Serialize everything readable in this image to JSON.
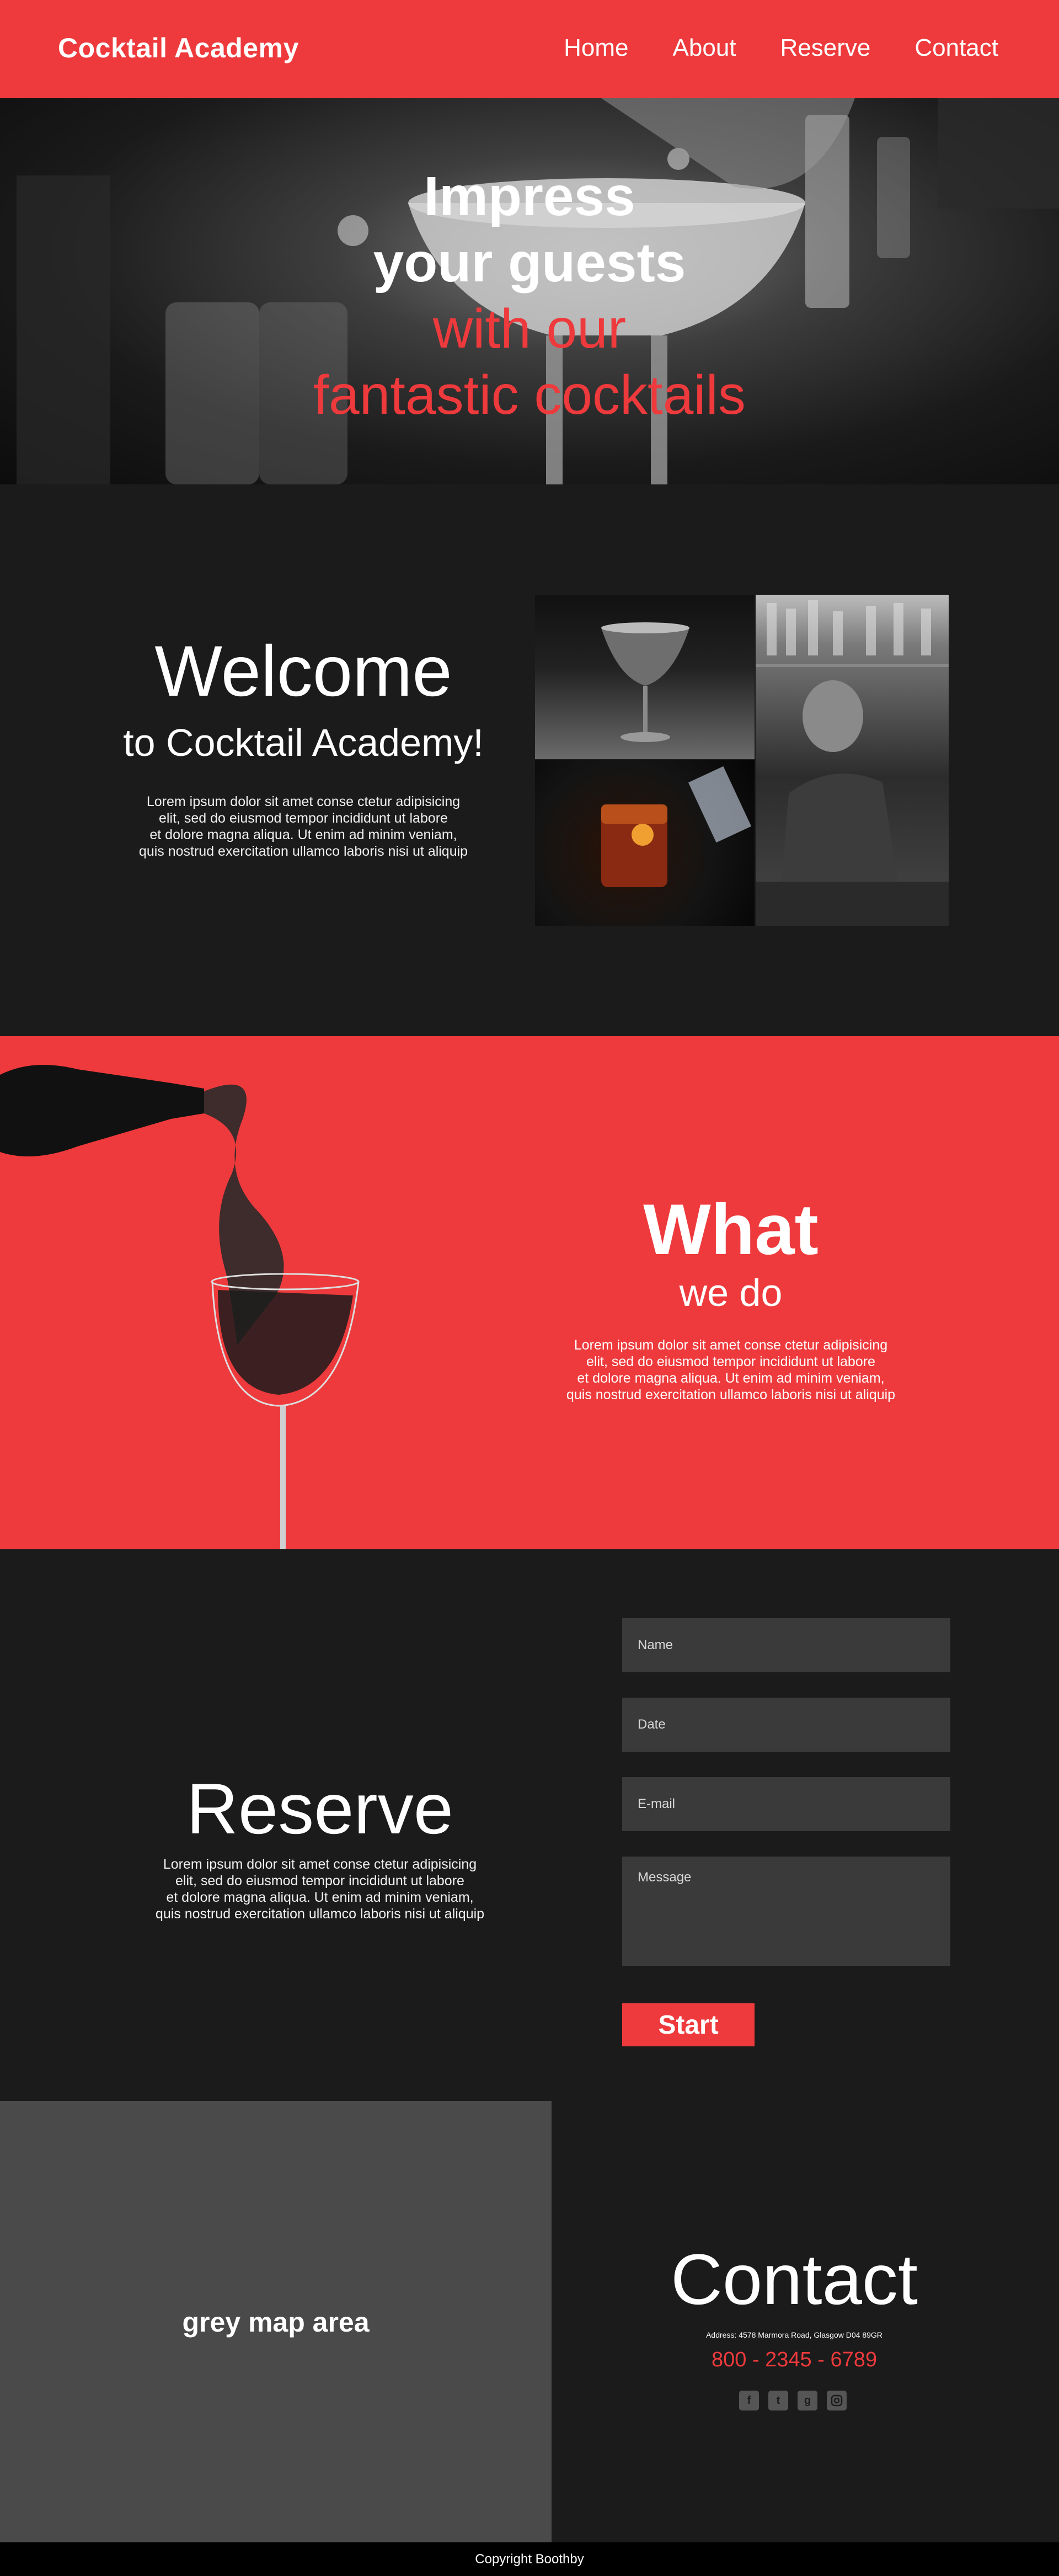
{
  "header": {
    "brand": "Cocktail Academy",
    "nav": [
      "Home",
      "About",
      "Reserve",
      "Contact"
    ]
  },
  "hero": {
    "line1": "Impress",
    "line2": "your guests",
    "line3": "with our",
    "line4": "fantastic cocktails"
  },
  "welcome": {
    "title": "Welcome",
    "subtitle": "to Cocktail Academy!",
    "body": [
      "Lorem ipsum dolor sit amet conse ctetur adipisicing",
      "elit, sed do eiusmod tempor  incididunt ut labore",
      "et dolore magna aliqua.  Ut enim ad minim veniam,",
      "quis nostrud exercitation ullamco laboris nisi ut aliquip"
    ]
  },
  "what": {
    "title": "What",
    "subtitle": "we do",
    "body": [
      "Lorem ipsum dolor sit amet conse ctetur adipisicing",
      "elit, sed do eiusmod tempor  incididunt ut labore",
      "et dolore magna aliqua.  Ut enim ad minim veniam,",
      "quis nostrud exercitation ullamco laboris nisi ut aliquip"
    ]
  },
  "reserve": {
    "title": "Reserve",
    "body": [
      "Lorem ipsum dolor sit amet conse ctetur adipisicing",
      "elit, sed do eiusmod tempor  incididunt ut labore",
      "et dolore magna aliqua.  Ut enim ad minim veniam,",
      "quis nostrud exercitation ullamco laboris nisi ut aliquip"
    ],
    "form": {
      "name_placeholder": "Name",
      "date_placeholder": "Date",
      "email_placeholder": "E-mail",
      "message_placeholder": "Message",
      "submit_label": "Start"
    }
  },
  "map": {
    "label": "grey map area"
  },
  "contact": {
    "title": "Contact",
    "address": "Address: 4578 Marmora Road, Glasgow D04 89GR",
    "phone": "800 - 2345 - 6789",
    "social_icons": [
      "facebook-icon",
      "twitter-icon",
      "google-plus-icon",
      "instagram-icon"
    ]
  },
  "footer": {
    "copyright": "Copyright Boothby"
  },
  "colors": {
    "accent": "#ee3a3c",
    "dark": "#1b1b1b",
    "field": "#3a3a3a",
    "map": "#4b4a4b"
  }
}
